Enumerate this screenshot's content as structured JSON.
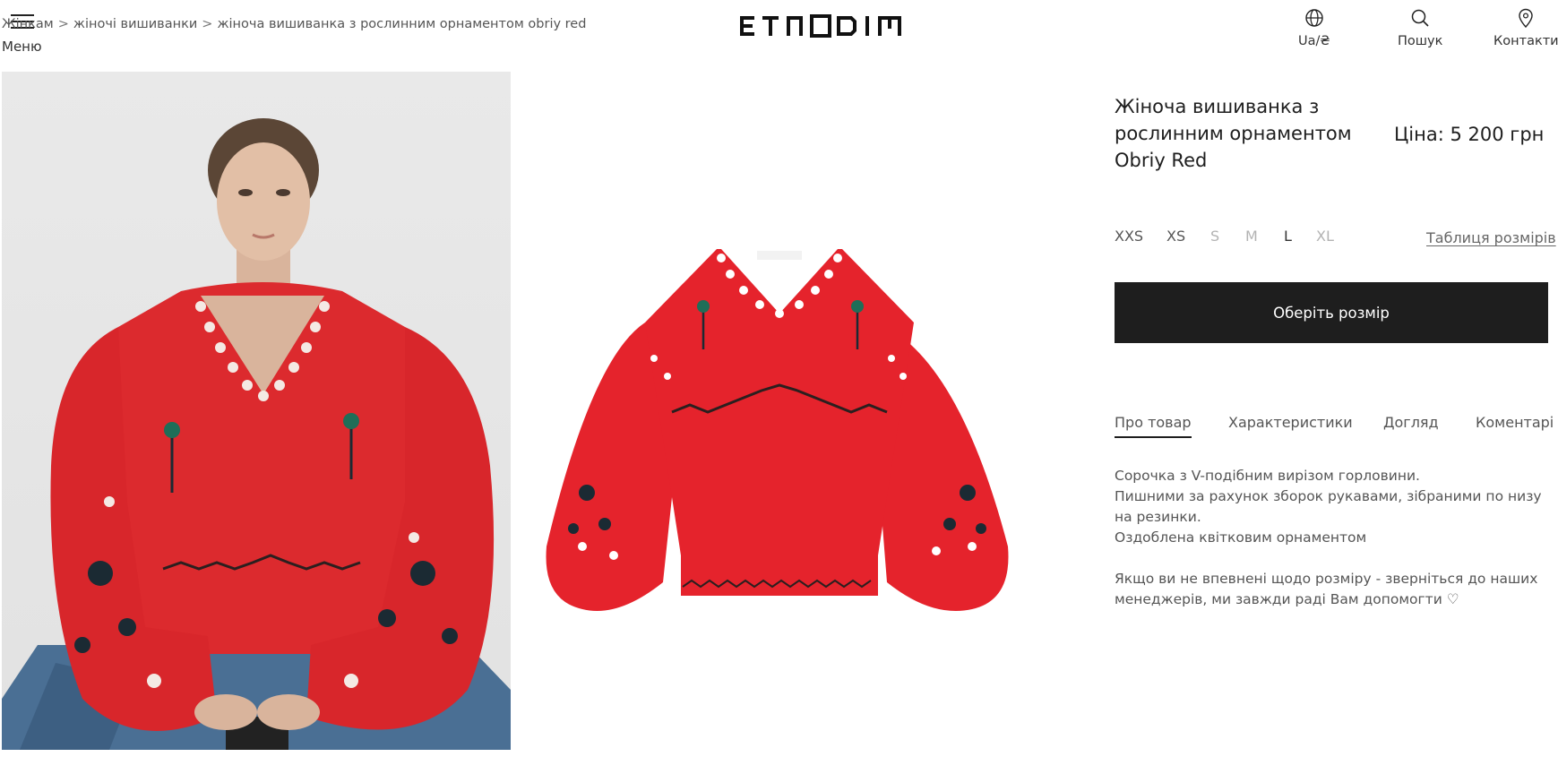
{
  "header": {
    "menu_label": "Меню",
    "breadcrumb": [
      "Жінкам",
      "жіночі вишиванки",
      "жіноча вишиванка з рослинним орнаментом obriy red"
    ],
    "breadcrumb_separator": ">",
    "logo_text": "ETNODIM",
    "locale_label": "Ua/₴",
    "search_label": "Пошук",
    "contacts_label": "Контакти"
  },
  "product": {
    "title": "Жіноча вишиванка з рослинним орнаментом Obriy Red",
    "price": "Ціна: 5 200 грн",
    "sizes": [
      {
        "label": "XXS",
        "available": true
      },
      {
        "label": "XS",
        "available": true
      },
      {
        "label": "S",
        "available": false
      },
      {
        "label": "M",
        "available": false
      },
      {
        "label": "L",
        "available": true
      },
      {
        "label": "XL",
        "available": false
      }
    ],
    "size_table_link": "Таблиця розмірів",
    "choose_size_button": "Оберіть розмір",
    "tabs": [
      "Про товар",
      "Характеристики",
      "Догляд",
      "Коментарі"
    ],
    "active_tab": "Про товар",
    "description": [
      "Сорочка з V-подібним вирізом горловини.",
      "Пишними за рахунок зборок рукавами, зібраними по низу на резинки.",
      "Оздоблена квітковим орнаментом"
    ],
    "note": "Якщо ви не впевнені щодо розміру - зверніться до наших менеджерів, ми завжди раді Вам допомогти ♡"
  },
  "colors": {
    "text": "#1e1e1e",
    "button_bg": "#1e1e1e",
    "muted_size": "#b3b3b3",
    "garment_red": "#e5232c"
  },
  "icons": {
    "menu": "hamburger-icon",
    "locale": "globe-icon",
    "search": "search-icon",
    "contacts": "location-pin-icon"
  }
}
